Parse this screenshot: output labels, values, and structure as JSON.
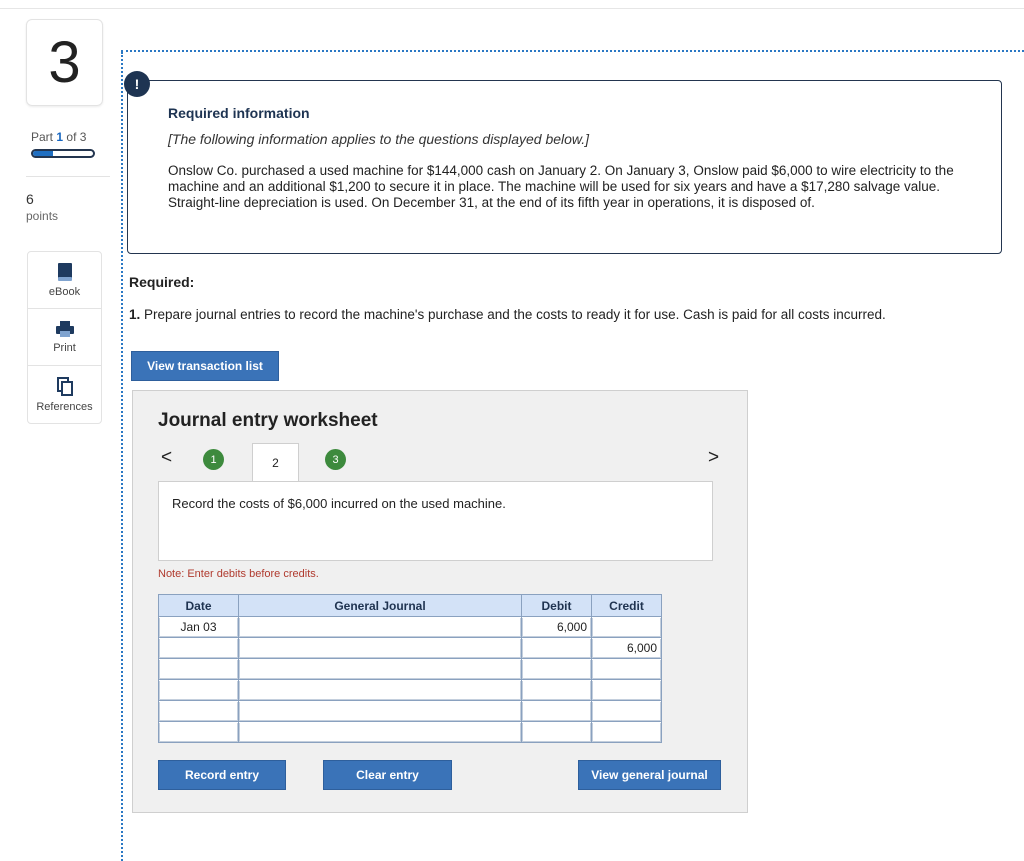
{
  "question": {
    "number": "3",
    "part_label": "Part",
    "part_num": "1",
    "part_of": "of 3",
    "part_progress": 0.3333,
    "points_value": "6",
    "points_label": "points"
  },
  "tools": [
    {
      "label": "eBook",
      "icon": "book-icon"
    },
    {
      "label": "Print",
      "icon": "printer-icon"
    },
    {
      "label": "References",
      "icon": "documents-icon"
    }
  ],
  "alert_icon": "!",
  "info": {
    "title": "Required information",
    "subtitle": "[The following information applies to the questions displayed below.]",
    "body": "Onslow Co. purchased a used machine for $144,000 cash on January 2. On January 3, Onslow paid $6,000 to wire electricity to the machine and an additional $1,200 to secure it in place. The machine will be used for six years and have a $17,280 salvage value. Straight-line depreciation is used. On December 31, at the end of its fifth year in operations, it is disposed of."
  },
  "required": {
    "heading": "Required:",
    "question_num": "1.",
    "question_text": "Prepare journal entries to record the machine's purchase and the costs to ready it for use. Cash is paid for all costs incurred."
  },
  "view_transaction_list": "View transaction list",
  "worksheet": {
    "title": "Journal entry worksheet",
    "prev": "<",
    "next": ">",
    "steps": [
      "1",
      "2",
      "3"
    ],
    "description": "Record the costs of $6,000 incurred on the used machine.",
    "note": "Note: Enter debits before credits.",
    "headers": {
      "date": "Date",
      "account": "General Journal",
      "debit": "Debit",
      "credit": "Credit"
    },
    "rows": [
      {
        "date": "Jan 03",
        "account": "",
        "debit": "6,000",
        "credit": ""
      },
      {
        "date": "",
        "account": "",
        "debit": "",
        "credit": "6,000"
      },
      {
        "date": "",
        "account": "",
        "debit": "",
        "credit": ""
      },
      {
        "date": "",
        "account": "",
        "debit": "",
        "credit": ""
      },
      {
        "date": "",
        "account": "",
        "debit": "",
        "credit": ""
      },
      {
        "date": "",
        "account": "",
        "debit": "",
        "credit": ""
      }
    ],
    "buttons": {
      "record": "Record entry",
      "clear": "Clear entry",
      "view_journal": "View general journal"
    }
  },
  "colors": {
    "accent": "#3a73b8",
    "progress": "#1f6fc2",
    "step_done": "#3d8a3d",
    "header_bg": "#d3e2f7",
    "note": "#b03a2e",
    "alert": "#1e3452"
  }
}
